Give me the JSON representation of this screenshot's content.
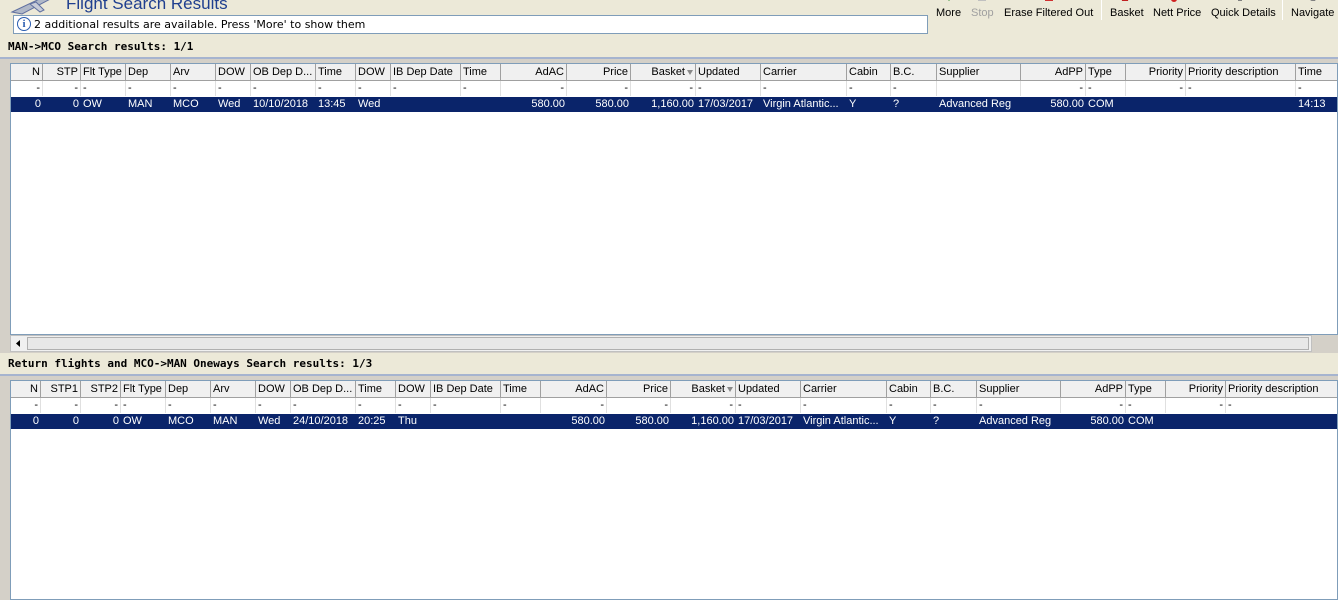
{
  "header": {
    "title": "Flight Search Results",
    "info_text": "2 additional results are available. Press 'More' to show them"
  },
  "toolbar": {
    "more": "More",
    "stop": "Stop",
    "erase": "Erase Filtered Out",
    "basket": "Basket",
    "nett_price": "Nett Price",
    "quick_details": "Quick Details",
    "navigate": "Navigate"
  },
  "outbound": {
    "title": "MAN->MCO Search results: 1/1",
    "columns": [
      "N",
      "STP",
      "Flt Type",
      "Dep",
      "Arv",
      "DOW",
      "OB Dep D...",
      "Time",
      "DOW",
      "IB Dep Date",
      "Time",
      "AdAC",
      "Price",
      "Basket",
      "Updated",
      "Carrier",
      "Cabin",
      "B.C.",
      "Supplier",
      "AdPP",
      "Type",
      "Priority",
      "Priority description",
      "Time"
    ],
    "filter": [
      "-",
      "-",
      "-",
      "-",
      "-",
      "-",
      "-",
      "-",
      "-",
      "-",
      "-",
      "-",
      "-",
      "-",
      "-",
      "-",
      "-",
      "-",
      "",
      "-",
      "-",
      "-",
      "-",
      "-"
    ],
    "rows": [
      [
        "0",
        "0",
        "OW",
        "MAN",
        "MCO",
        "Wed",
        "10/10/2018",
        "13:45",
        "Wed",
        "",
        "",
        "580.00",
        "580.00",
        "1,160.00",
        "17/03/2017",
        "Virgin Atlantic...",
        "Y",
        "?",
        "Advanced Reg",
        "580.00",
        "COM",
        "",
        "",
        "14:13"
      ]
    ]
  },
  "inbound": {
    "title": "Return flights and MCO->MAN Oneways Search results: 1/3",
    "columns": [
      "N",
      "STP1",
      "STP2",
      "Flt Type",
      "Dep",
      "Arv",
      "DOW",
      "OB Dep D...",
      "Time",
      "DOW",
      "IB Dep Date",
      "Time",
      "AdAC",
      "Price",
      "Basket",
      "Updated",
      "Carrier",
      "Cabin",
      "B.C.",
      "Supplier",
      "AdPP",
      "Type",
      "Priority",
      "Priority description"
    ],
    "filter": [
      "-",
      "-",
      "-",
      "-",
      "-",
      "-",
      "-",
      "-",
      "-",
      "-",
      "-",
      "-",
      "-",
      "-",
      "-",
      "-",
      "-",
      "-",
      "-",
      "-",
      "-",
      "-",
      "-",
      "-"
    ],
    "rows": [
      [
        "0",
        "0",
        "0",
        "OW",
        "MCO",
        "MAN",
        "Wed",
        "24/10/2018",
        "20:25",
        "Thu",
        "",
        "",
        "580.00",
        "580.00",
        "1,160.00",
        "17/03/2017",
        "Virgin Atlantic...",
        "Y",
        "?",
        "Advanced Reg",
        "580.00",
        "COM",
        "",
        ""
      ]
    ]
  },
  "colors": {
    "selection": "#0a246a",
    "title": "#1f3f8f"
  }
}
